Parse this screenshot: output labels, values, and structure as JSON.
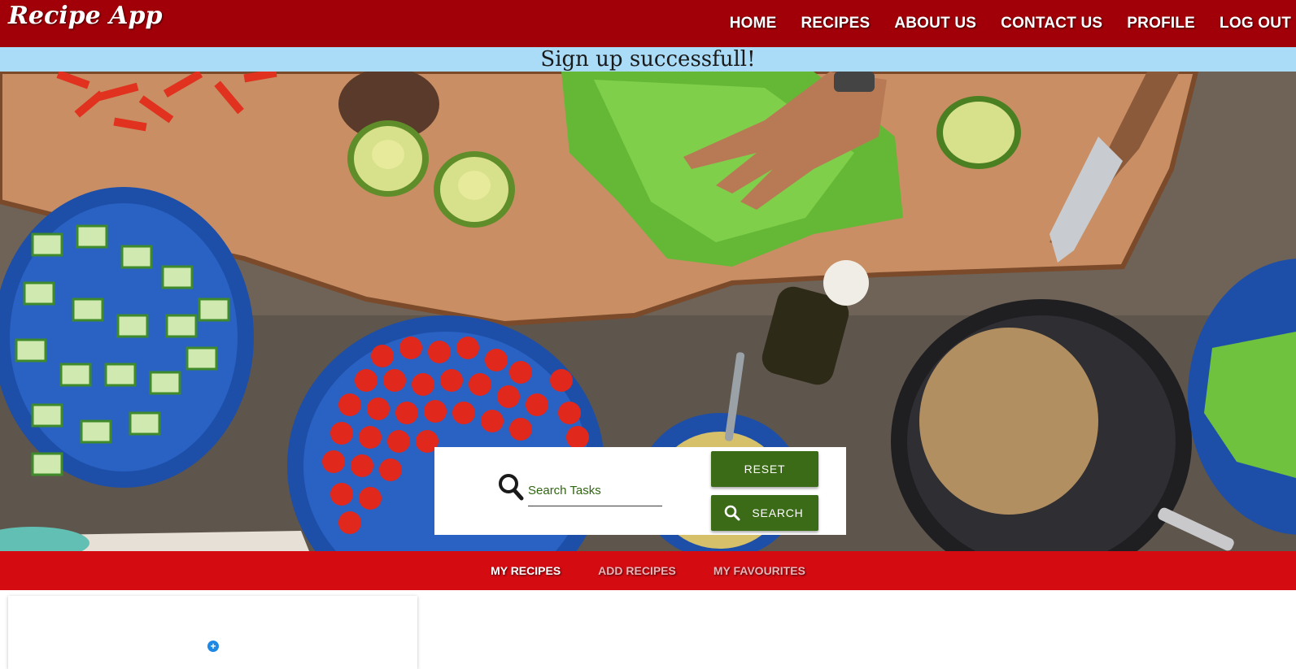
{
  "app": {
    "title": "Recipe App"
  },
  "nav": {
    "items": [
      {
        "label": "HOME"
      },
      {
        "label": "RECIPES"
      },
      {
        "label": "ABOUT US"
      },
      {
        "label": "CONTACT US"
      },
      {
        "label": "PROFILE"
      },
      {
        "label": "LOG OUT"
      }
    ]
  },
  "flash": {
    "message": "Sign up successfull!"
  },
  "hero": {
    "image": "vegetables-on-table-photo"
  },
  "search": {
    "placeholder": "Search Tasks",
    "value": "",
    "icon": "search-icon",
    "reset_label": "RESET",
    "search_label": "SEARCH"
  },
  "subnav": {
    "items": [
      {
        "label": "MY RECIPES",
        "active": true
      },
      {
        "label": "ADD RECIPES",
        "active": false
      },
      {
        "label": "MY FAVOURITES",
        "active": false
      }
    ]
  },
  "card": {
    "add_icon": "plus-circle-icon"
  },
  "colors": {
    "navbar": "#a10009",
    "flash": "#aadcf8",
    "button": "#3b6b17",
    "subnav": "#d50b12",
    "accent_blue": "#1e88e5"
  }
}
